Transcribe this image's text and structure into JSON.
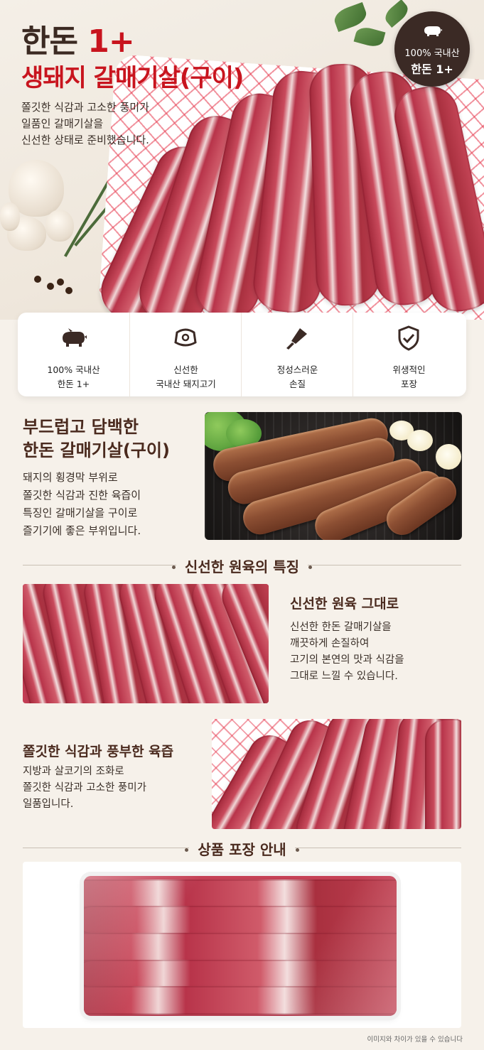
{
  "hero": {
    "title_prefix": "한돈 ",
    "title_accent": "1+",
    "subtitle": "생돼지 갈매기살(구이)",
    "description": "쫄깃한 식감과 고소한 풍미가\n일품인 갈매기살을\n신선한 상태로 준비했습니다."
  },
  "badge": {
    "icon": "pig-icon",
    "line1": "100% 국내산",
    "line2": "한돈 1+"
  },
  "features": [
    {
      "icon": "pig-icon",
      "line1": "100% 국내산",
      "line2": "한돈 1+"
    },
    {
      "icon": "meat-cut-icon",
      "line1": "신선한",
      "line2": "국내산 돼지고기"
    },
    {
      "icon": "knife-icon",
      "line1": "정성스러운",
      "line2": "손질"
    },
    {
      "icon": "shield-check-icon",
      "line1": "위생적인",
      "line2": "포장"
    }
  ],
  "intro": {
    "title": "부드럽고 담백한\n한돈 갈매기살(구이)",
    "description": "돼지의 횡경막 부위로\n쫄깃한 식감과 진한 육즙이\n특징인 갈매기살을 구이로\n즐기기에 좋은 부위입니다."
  },
  "section_fresh": {
    "heading": "신선한 원육의 특징",
    "item1": {
      "title": "신선한 원육 그대로",
      "description": "신선한 한돈 갈매기살을\n깨끗하게 손질하여\n고기의 본연의 맛과 식감을\n그대로 느낄 수 있습니다."
    },
    "item2": {
      "title": "쫄깃한 식감과 풍부한 육즙",
      "description": "지방과 살코기의 조화로\n쫄깃한 식감과 고소한 풍미가\n일품입니다."
    }
  },
  "section_package": {
    "heading": "상품 포장 안내"
  },
  "disclaimer": "이미지와 차이가 있을 수 있습니다",
  "colors": {
    "accent_red": "#c8141e",
    "dark_brown": "#3b2a25",
    "heading_brown": "#4a2a1e",
    "background": "#f6f1ea"
  }
}
